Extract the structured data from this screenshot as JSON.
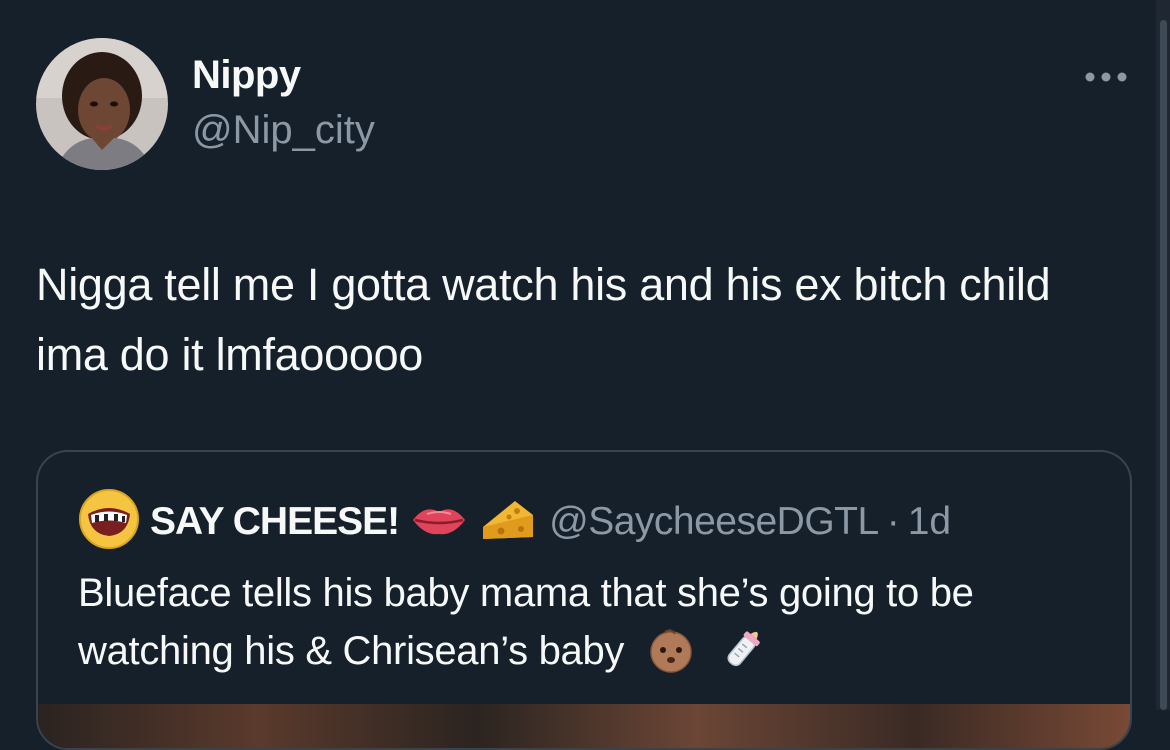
{
  "tweet": {
    "author": {
      "display_name": "Nippy",
      "handle": "@Nip_city",
      "avatar_icon": "profile-photo"
    },
    "more_icon": "more-horizontal-icon",
    "text": "Nigga tell me I gotta watch his and his ex bitch child ima do it lmfaooooo"
  },
  "quote": {
    "avatar_icon": "grinning-face-avatar",
    "display_name": "SAY CHEESE!",
    "name_emojis": [
      "lips-icon",
      "cheese-icon"
    ],
    "handle": "@SaycheeseDGTL",
    "separator": "·",
    "time": "1d",
    "text": "Blueface tells his baby mama that she’s going to be watching his & Chrisean’s baby",
    "text_emojis": [
      "baby-face-icon",
      "baby-bottle-icon"
    ]
  },
  "colors": {
    "background": "#15202b",
    "text_primary": "#f7f9f9",
    "text_secondary": "#8b98a5",
    "border": "#38444d"
  }
}
